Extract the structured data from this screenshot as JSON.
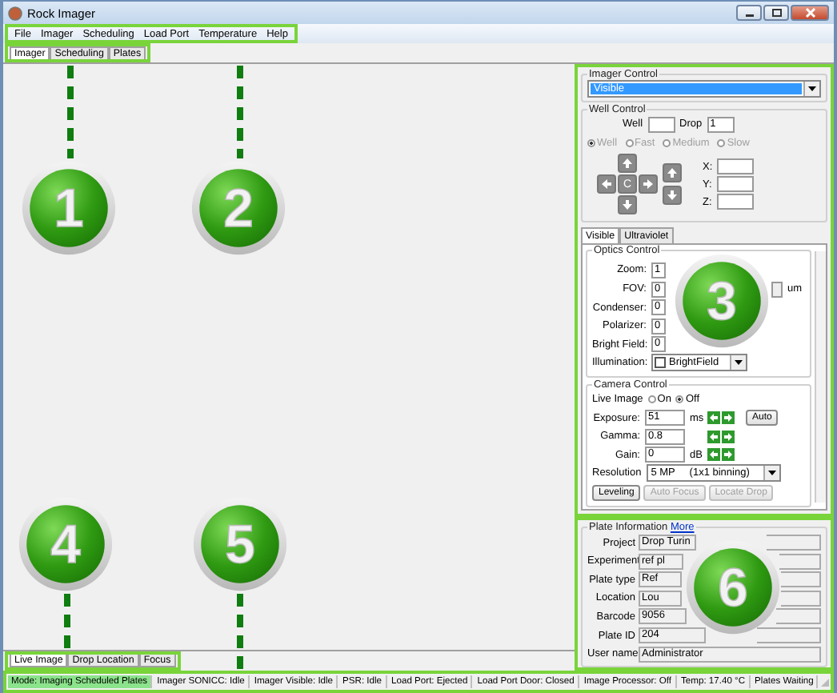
{
  "window": {
    "title": "Rock Imager"
  },
  "menu": [
    "File",
    "Imager",
    "Scheduling",
    "Load Port",
    "Temperature",
    "Help"
  ],
  "tabs": [
    {
      "label": "Imager",
      "selected": true
    },
    {
      "label": "Scheduling",
      "selected": false
    },
    {
      "label": "Plates",
      "selected": false
    }
  ],
  "imager_control": {
    "title": "Imager Control",
    "mode": "Visible"
  },
  "well_control": {
    "title": "Well Control",
    "well_label": "Well",
    "drop_label": "Drop",
    "drop": "1",
    "center": "C",
    "disabled": true,
    "speeds": [
      {
        "label": "Well",
        "selected": true
      },
      {
        "label": "Fast",
        "selected": false
      },
      {
        "label": "Medium",
        "selected": false
      },
      {
        "label": "Slow",
        "selected": false
      }
    ],
    "coords": [
      "X:",
      "Y:",
      "Z:"
    ]
  },
  "optics_tabs": [
    {
      "label": "Visible",
      "selected": true
    },
    {
      "label": "Ultraviolet",
      "selected": false
    }
  ],
  "optics_control": {
    "title": "Optics Control",
    "fields": [
      {
        "label": "Zoom:",
        "value": "1"
      },
      {
        "label": "FOV:",
        "value": "0",
        "unit": "um"
      },
      {
        "label": "Condenser:",
        "value": "0"
      },
      {
        "label": "Polarizer:",
        "value": "0"
      },
      {
        "label": "Bright Field:",
        "value": "0"
      }
    ],
    "illumination": {
      "label": "Illumination:",
      "value": "BrightField",
      "checked": false
    }
  },
  "camera_control": {
    "title": "Camera Control",
    "live_image": {
      "label": "Live Image",
      "options": [
        {
          "label": "On",
          "selected": false
        },
        {
          "label": "Off",
          "selected": true
        }
      ]
    },
    "fields": [
      {
        "label": "Exposure:",
        "value": "51",
        "unit": "ms",
        "auto": "Auto"
      },
      {
        "label": "Gamma:",
        "value": "0.8"
      },
      {
        "label": "Gain:",
        "value": "0",
        "unit": "dB"
      }
    ],
    "resolution": {
      "label": "Resolution",
      "value": "5 MP     (1x1 binning)"
    },
    "buttons": [
      {
        "label": "Leveling",
        "disabled": false
      },
      {
        "label": "Auto Focus",
        "disabled": true
      },
      {
        "label": "Locate Drop",
        "disabled": true
      }
    ]
  },
  "plate_information": {
    "title": "Plate Information",
    "link": "More",
    "fields": [
      {
        "label": "Project",
        "value": "Drop Turin"
      },
      {
        "label": "Experiment",
        "value": "ref pl"
      },
      {
        "label": "Plate type",
        "value": "Ref"
      },
      {
        "label": "Location",
        "value": "Lou"
      },
      {
        "label": "Barcode",
        "value": "9056"
      },
      {
        "label": "Plate ID",
        "value": "204"
      },
      {
        "label": "User name",
        "value": "Administrator"
      }
    ]
  },
  "bottom_tabs": [
    {
      "label": "Live Image",
      "selected": true
    },
    {
      "label": "Drop Location",
      "selected": false
    },
    {
      "label": "Focus",
      "selected": false
    }
  ],
  "status_bar": [
    {
      "text": "Mode: Imaging Scheduled Plates",
      "highlighted": true
    },
    {
      "text": "Imager SONICC: Idle",
      "highlighted": false
    },
    {
      "text": "Imager Visible: Idle",
      "highlighted": false
    },
    {
      "text": "PSR: Idle",
      "highlighted": false
    },
    {
      "text": "Load Port: Ejected",
      "highlighted": false
    },
    {
      "text": "Load Port Door: Closed",
      "highlighted": false
    },
    {
      "text": "Image Processor: Off",
      "highlighted": false
    },
    {
      "text": "Temp: 17.40 °C",
      "highlighted": false
    },
    {
      "text": "Plates Waiting",
      "highlighted": false
    }
  ],
  "callouts": [
    "1",
    "2",
    "3",
    "4",
    "5",
    "6"
  ]
}
